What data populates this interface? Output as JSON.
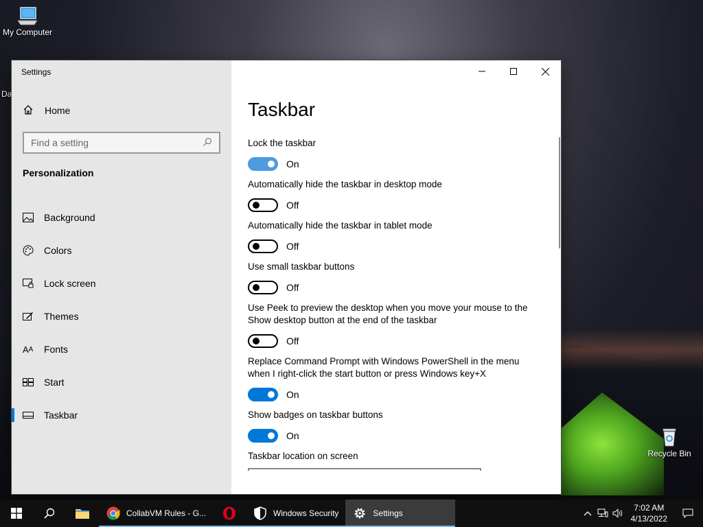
{
  "desktop": {
    "icons": [
      {
        "label": "My Computer"
      },
      {
        "label": "Recycle Bin"
      }
    ],
    "cut_label": "Da"
  },
  "window": {
    "title": "Settings",
    "controls": {
      "minimize": "—",
      "maximize": "☐",
      "close": "✕"
    }
  },
  "sidebar": {
    "home": "Home",
    "search_placeholder": "Find a setting",
    "section": "Personalization",
    "items": [
      {
        "label": "Background",
        "icon": "image-icon"
      },
      {
        "label": "Colors",
        "icon": "palette-icon"
      },
      {
        "label": "Lock screen",
        "icon": "lock-screen-icon"
      },
      {
        "label": "Themes",
        "icon": "themes-icon"
      },
      {
        "label": "Fonts",
        "icon": "fonts-icon"
      },
      {
        "label": "Start",
        "icon": "start-icon"
      },
      {
        "label": "Taskbar",
        "icon": "taskbar-icon",
        "active": true
      }
    ]
  },
  "main": {
    "title": "Taskbar",
    "settings": [
      {
        "label": "Lock the taskbar",
        "state": "On"
      },
      {
        "label": "Automatically hide the taskbar in desktop mode",
        "state": "Off"
      },
      {
        "label": "Automatically hide the taskbar in tablet mode",
        "state": "Off"
      },
      {
        "label": "Use small taskbar buttons",
        "state": "Off"
      },
      {
        "label": "Use Peek to preview the desktop when you move your mouse to the Show desktop button at the end of the taskbar",
        "state": "Off"
      },
      {
        "label": "Replace Command Prompt with Windows PowerShell in the menu when I right-click the start button or press Windows key+X",
        "state": "On"
      },
      {
        "label": "Show badges on taskbar buttons",
        "state": "On"
      }
    ],
    "location_label": "Taskbar location on screen"
  },
  "taskbar": {
    "apps": [
      {
        "label": "CollabVM Rules - G...",
        "icon": "chrome-icon"
      },
      {
        "label": "Windows Security",
        "icon": "shield-icon"
      },
      {
        "label": "Settings",
        "icon": "gear-icon"
      }
    ],
    "time": "7:02 AM",
    "date": "4/13/2022"
  },
  "colors": {
    "accent": "#0078d7",
    "sidebar_bg": "#e6e6e6",
    "taskbar_bg": "#101010"
  }
}
